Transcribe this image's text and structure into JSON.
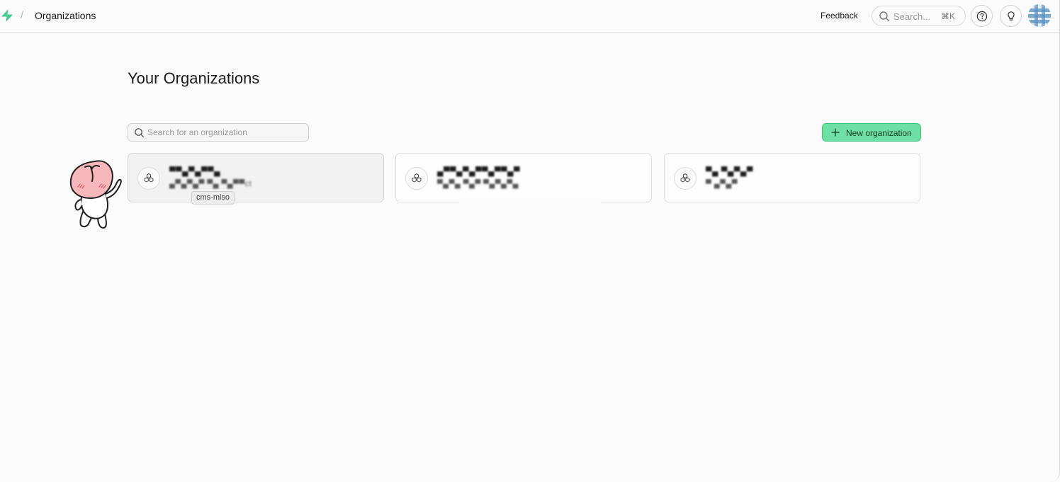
{
  "header": {
    "breadcrumb_separator": "/",
    "page_crumb": "Organizations",
    "feedback_label": "Feedback",
    "search_placeholder": "Search...",
    "search_shortcut": "⌘K",
    "help_icon": "help-circle-icon",
    "tips_icon": "lightbulb-icon",
    "brand_color": "#3ecf8e"
  },
  "main": {
    "title": "Your Organizations",
    "search_placeholder": "Search for an organization",
    "new_org_label": "New organization",
    "new_org_color": "#6fe0a3",
    "organizations": [
      {
        "name": "▀▀▄▀▄▀▀▄",
        "subtitle": "▄▀▄▀▄▀ ▀▄ ▀▄▀▀ct",
        "hovered": true
      },
      {
        "name": "▄▀▀▄▀▄▀▀▄▀▀▄▀",
        "subtitle": "▀▄▀▄ ▀▄▀ ▀▄▀▄▀▄",
        "hovered": false
      },
      {
        "name": "▀▄ ▀▄▀▄▀",
        "subtitle": "▀ ▄▀▄▀",
        "hovered": false
      }
    ],
    "tooltip": "cms-miso"
  }
}
